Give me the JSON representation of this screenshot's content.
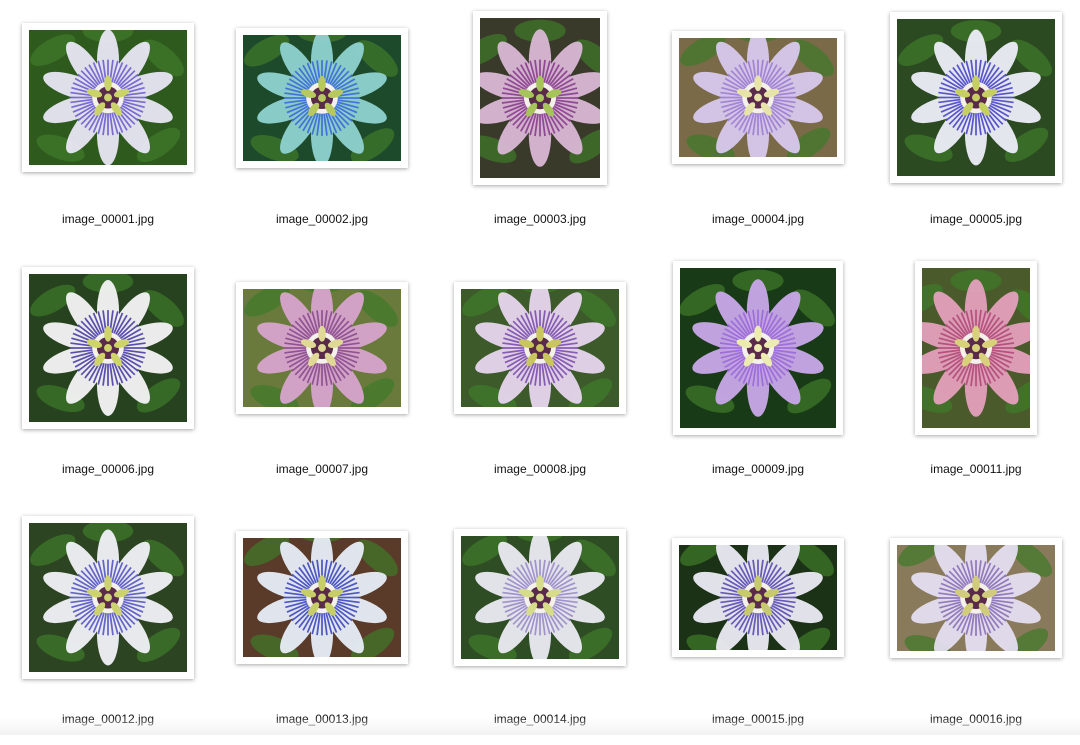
{
  "files": [
    {
      "name": "image_00001.jpg",
      "icon": "passion-flower-blue-image",
      "bg": "#2f5a1e",
      "petal": "#e9e7f5",
      "filament": "#6e5fd0",
      "center": "#c9d36a"
    },
    {
      "name": "image_00002.jpg",
      "icon": "passion-flower-teal-image",
      "bg": "#1e4a2c",
      "petal": "#8fd2d0",
      "filament": "#3c6ad8",
      "center": "#b7c85c"
    },
    {
      "name": "image_00003.jpg",
      "icon": "passion-flower-pink-image",
      "bg": "#3a3a2a",
      "petal": "#d9b7d4",
      "filament": "#8a3f8f",
      "center": "#a6c45a"
    },
    {
      "name": "image_00004.jpg",
      "icon": "passion-flower-frilly-image",
      "bg": "#7a6a48",
      "petal": "#d8c8ee",
      "filament": "#9d7fd0",
      "center": "#e6e4a8"
    },
    {
      "name": "image_00005.jpg",
      "icon": "passion-flower-blue-image",
      "bg": "#2c4a22",
      "petal": "#eeeefa",
      "filament": "#4a47c8",
      "center": "#c6cf62"
    },
    {
      "name": "image_00006.jpg",
      "icon": "passion-flower-white-image",
      "bg": "#27421f",
      "petal": "#f4f4f6",
      "filament": "#4c3fa8",
      "center": "#cfd46a"
    },
    {
      "name": "image_00007.jpg",
      "icon": "passion-flower-pink-image",
      "bg": "#6a7a3c",
      "petal": "#d7a4cc",
      "filament": "#8a4c8e",
      "center": "#e0d996"
    },
    {
      "name": "image_00008.jpg",
      "icon": "passion-flower-purple-image",
      "bg": "#3c5a2a",
      "petal": "#e8d6ee",
      "filament": "#7c4fae",
      "center": "#c9c660"
    },
    {
      "name": "image_00009.jpg",
      "icon": "passion-flower-lavender-image",
      "bg": "#183a16",
      "petal": "#c9a8ea",
      "filament": "#9b6ad8",
      "center": "#ecebb0"
    },
    {
      "name": "image_00011.jpg",
      "icon": "passion-flower-pink-star-image",
      "bg": "#4a5a2a",
      "petal": "#e4a0bc",
      "filament": "#b04c7a",
      "center": "#d8d07a"
    },
    {
      "name": "image_00012.jpg",
      "icon": "passion-flower-blue-image",
      "bg": "#2c4422",
      "petal": "#f1f2f8",
      "filament": "#5656c6",
      "center": "#cdd270"
    },
    {
      "name": "image_00013.jpg",
      "icon": "passion-flower-blue-image",
      "bg": "#5a3a28",
      "petal": "#e8eef8",
      "filament": "#3f48c0",
      "center": "#c8ce66"
    },
    {
      "name": "image_00014.jpg",
      "icon": "passion-flower-frilly-image",
      "bg": "#2f4d24",
      "petal": "#eceaf4",
      "filament": "#9a8cc8",
      "center": "#d6dc8a"
    },
    {
      "name": "image_00015.jpg",
      "icon": "passion-flower-blue-image",
      "bg": "#1c3216",
      "petal": "#ecebf6",
      "filament": "#5a4cb4",
      "center": "#c6ca6c"
    },
    {
      "name": "image_00016.jpg",
      "icon": "passion-flower-lavender-image",
      "bg": "#8a7a5c",
      "petal": "#e4def0",
      "filament": "#8a70b8",
      "center": "#d0cc7c"
    }
  ]
}
